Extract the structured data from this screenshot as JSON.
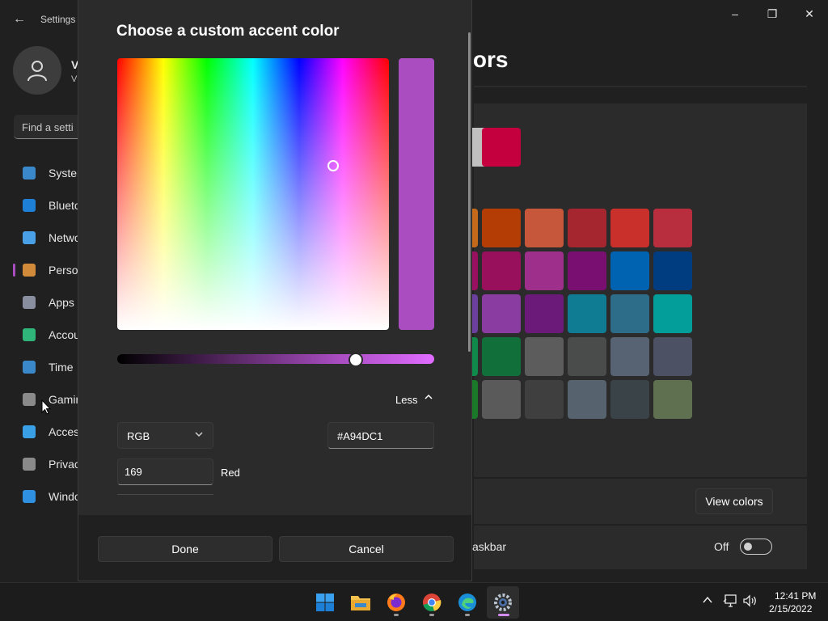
{
  "window": {
    "title": "Settings",
    "back_icon": "back-arrow-icon"
  },
  "window_controls": {
    "minimize": "–",
    "restore": "❐",
    "close": "✕"
  },
  "user": {
    "name_visible": "V",
    "sub_visible": "V"
  },
  "search": {
    "placeholder": "Find a setti"
  },
  "sidebar": {
    "items": [
      {
        "label": "Syster",
        "icon": "system-icon",
        "color": "#3a87c9"
      },
      {
        "label": "Blueto",
        "icon": "bluetooth-icon",
        "color": "#1e7fd6"
      },
      {
        "label": "Netwo",
        "icon": "network-icon",
        "color": "#4aa0e6"
      },
      {
        "label": "Perso",
        "icon": "personalization-icon",
        "color": "#d08a3a",
        "selected": true
      },
      {
        "label": "Apps",
        "icon": "apps-icon",
        "color": "#8a8fa0"
      },
      {
        "label": "Accou",
        "icon": "accounts-icon",
        "color": "#2fb57a"
      },
      {
        "label": "Time",
        "icon": "time-language-icon",
        "color": "#3a87c9"
      },
      {
        "label": "Gamin",
        "icon": "gaming-icon",
        "color": "#8a8a8a"
      },
      {
        "label": "Acces",
        "icon": "accessibility-icon",
        "color": "#3aa0e6"
      },
      {
        "label": "Privac",
        "icon": "privacy-icon",
        "color": "#8a8a8a"
      },
      {
        "label": "Windo",
        "icon": "windows-update-icon",
        "color": "#2f8fe0"
      }
    ]
  },
  "main": {
    "heading_visible": "olors",
    "recent_colors": [
      "#c0c0c0",
      "#c4003f"
    ],
    "windows_colors": [
      [
        "#c46a1a",
        "#b43c05",
        "#c6573a",
        "#a5262f",
        "#c9302c",
        "#b82e3f"
      ],
      [
        "#9a1060",
        "#98105c",
        "#9e2f8a",
        "#7a0f72",
        "#0063b1",
        "#003d80"
      ],
      [
        "#6b3fa0",
        "#8a3ca0",
        "#6b1a7a",
        "#0f7c93",
        "#2d6d8a",
        "#039d9a"
      ],
      [
        "#0f8a4a",
        "#11703a",
        "#5c5c5c",
        "#4a4c4c",
        "#576373",
        "#4c5264"
      ],
      [
        "#1a7a2a",
        "#5a5a5a",
        "#3f3f3f",
        "#56626e",
        "#3a4448",
        "#5f7050"
      ]
    ],
    "view_colors_label": "View colors",
    "taskbar_text_visible": "askbar",
    "toggle_label": "Off"
  },
  "dialog": {
    "title": "Choose a custom accent color",
    "selected_color": "#A94DC1",
    "less_label": "Less",
    "less_icon": "chevron-up-icon",
    "color_model": "RGB",
    "hex_value": "#A94DC1",
    "red_value": "169",
    "red_label": "Red",
    "done_label": "Done",
    "cancel_label": "Cancel"
  },
  "taskbar": {
    "apps": [
      {
        "name": "start",
        "icon": "windows-start-icon"
      },
      {
        "name": "file-explorer",
        "icon": "folder-icon"
      },
      {
        "name": "firefox",
        "icon": "firefox-icon"
      },
      {
        "name": "chrome",
        "icon": "chrome-icon"
      },
      {
        "name": "edge",
        "icon": "edge-icon"
      },
      {
        "name": "settings",
        "icon": "settings-gear-icon"
      }
    ],
    "tray_chevron": "^",
    "clock_time": "12:41 PM",
    "clock_date": "2/15/2022"
  }
}
